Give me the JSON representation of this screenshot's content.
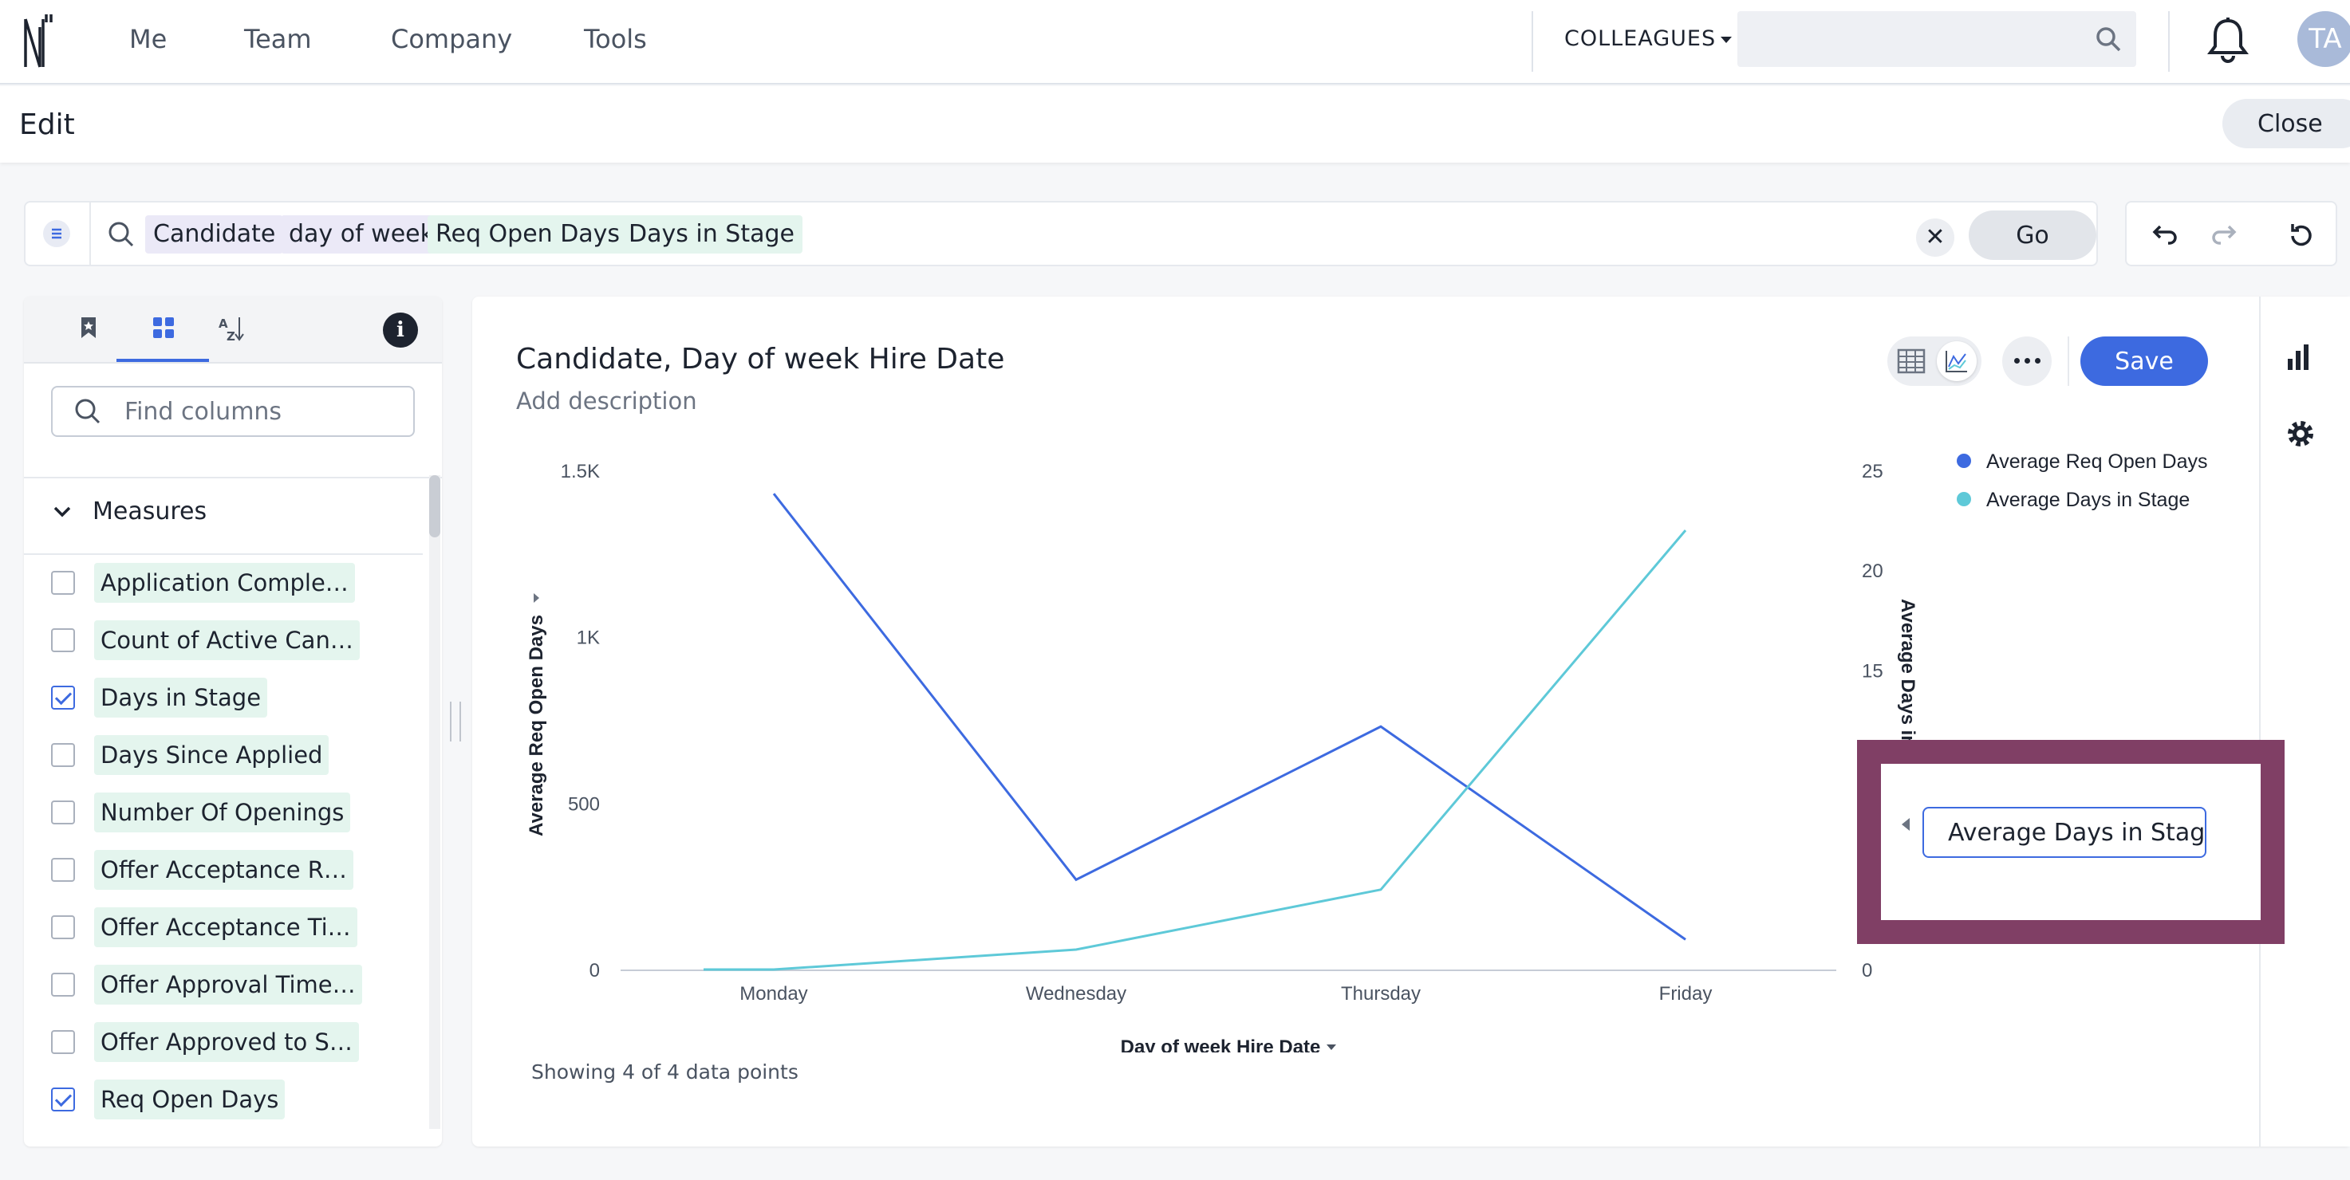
{
  "topnav": {
    "items": [
      "Me",
      "Team",
      "Company",
      "Tools"
    ],
    "colleagues_label": "COLLEAGUES",
    "search_value": "",
    "avatar_initials": "TA"
  },
  "editbar": {
    "title": "Edit",
    "close_label": "Close"
  },
  "searchbar": {
    "tokens": [
      {
        "label": "Candidate",
        "kind": "attribute"
      },
      {
        "label": "day of week",
        "kind": "attribute"
      },
      {
        "label": "Req Open Days",
        "kind": "measure"
      },
      {
        "label": "Days in Stage",
        "kind": "measure"
      }
    ],
    "clear_label": "✕",
    "go_label": "Go"
  },
  "left_panel": {
    "find_placeholder": "Find columns",
    "section_label": "Measures",
    "columns": [
      {
        "label": "Application Comple…",
        "checked": false
      },
      {
        "label": "Count of Active Can…",
        "checked": false
      },
      {
        "label": "Days in Stage",
        "checked": true
      },
      {
        "label": "Days Since Applied",
        "checked": false
      },
      {
        "label": "Number Of Openings",
        "checked": false
      },
      {
        "label": "Offer Acceptance R…",
        "checked": false
      },
      {
        "label": "Offer Acceptance Ti…",
        "checked": false
      },
      {
        "label": "Offer Approval Time…",
        "checked": false
      },
      {
        "label": "Offer Approved to S…",
        "checked": false
      },
      {
        "label": "Req Open Days",
        "checked": true
      }
    ]
  },
  "main": {
    "title": "Candidate, Day of week Hire Date",
    "description": "Add description",
    "save_label": "Save",
    "footer": "Showing 4 of 4 data points",
    "axis_name_input": "Average Days in Stage"
  },
  "chart_data": {
    "type": "line",
    "categories": [
      "Monday",
      "Wednesday",
      "Thursday",
      "Friday"
    ],
    "xlabel": "Day of week Hire Date",
    "series": [
      {
        "name": "Average Req Open Days",
        "axis": "left",
        "color": "#3d6ae0",
        "values": [
          1430,
          270,
          730,
          90
        ]
      },
      {
        "name": "Average Days in Stage",
        "axis": "right",
        "color": "#5ec9d8",
        "values": [
          0,
          1,
          4,
          22
        ]
      }
    ],
    "y_left": {
      "label": "Average Req Open Days",
      "ticks": [
        "0",
        "500",
        "1K",
        "1.5K"
      ],
      "tick_values": [
        0,
        500,
        1000,
        1500
      ],
      "range": [
        0,
        1500
      ]
    },
    "y_right": {
      "label": "Average Days in Stage",
      "ticks": [
        "0",
        "15",
        "20",
        "25"
      ],
      "tick_values": [
        0,
        15,
        20,
        25
      ],
      "range": [
        0,
        25
      ]
    },
    "legend_position": "top-right",
    "grid": false
  }
}
